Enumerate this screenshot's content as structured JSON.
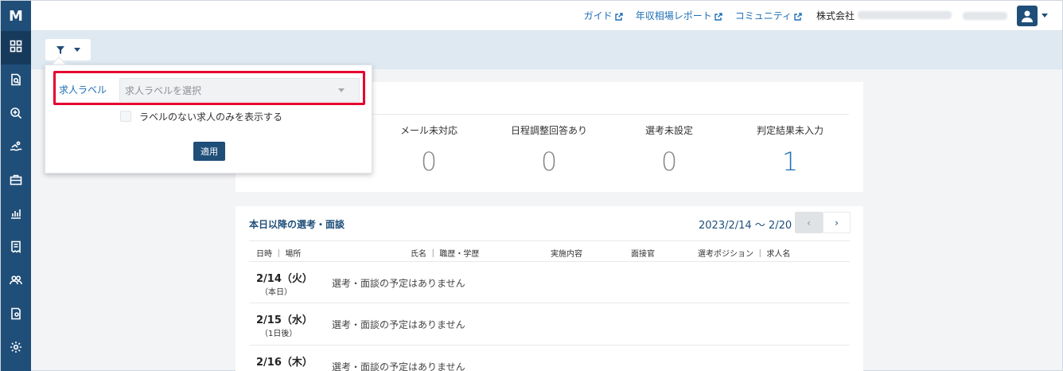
{
  "sidebar": {
    "logo": "M",
    "items": [
      {
        "icon": "dashboard-icon"
      },
      {
        "icon": "document-search-icon"
      },
      {
        "icon": "search-plus-icon"
      },
      {
        "icon": "swimmer-icon"
      },
      {
        "icon": "briefcase-icon"
      },
      {
        "icon": "bar-chart-icon"
      },
      {
        "icon": "receipt-icon"
      },
      {
        "icon": "users-icon"
      },
      {
        "icon": "document-settings-icon"
      },
      {
        "icon": "gear-icon"
      }
    ]
  },
  "header": {
    "links": [
      {
        "label": "ガイド",
        "icon": "external-link-icon"
      },
      {
        "label": "年収相場レポート",
        "icon": "external-link-icon"
      },
      {
        "label": "コミュニティ",
        "icon": "external-link-icon"
      }
    ],
    "company_prefix": "株式会社"
  },
  "filter_popup": {
    "label": "求人ラベル",
    "select_placeholder": "求人ラベルを選択",
    "checkbox_label": "ラベルのない求人のみを表示する",
    "apply_label": "適用"
  },
  "summary": {
    "stats": [
      {
        "label": "メール未対応",
        "value": "0"
      },
      {
        "label": "日程調整回答あり",
        "value": "0"
      },
      {
        "label": "選考未設定",
        "value": "0"
      },
      {
        "label": "判定結果未入力",
        "value": "1"
      }
    ]
  },
  "schedule": {
    "title": "本日以降の選考・面談",
    "date_range": "2023/2/14 ～ 2/20",
    "prev": "‹",
    "next": "›",
    "columns": [
      "日時 ｜ 場所",
      "氏名 ｜ 職歴・学歴",
      "実施内容",
      "面接官",
      "選考ポジション ｜ 求人名"
    ],
    "rows": [
      {
        "date": "2/14（火）",
        "sub": "（本日）",
        "message": "選考・面談の予定はありません"
      },
      {
        "date": "2/15（水）",
        "sub": "（1日後）",
        "message": "選考・面談の予定はありません"
      },
      {
        "date": "2/16（木）",
        "sub": "",
        "message": "選考・面談の予定はありません"
      }
    ]
  },
  "colors": {
    "sidebar": "#1f4e79",
    "link": "#1e6fb5",
    "highlight_border": "#e5002f",
    "filter_bar": "#dfe9f2"
  }
}
